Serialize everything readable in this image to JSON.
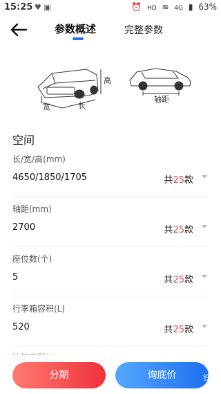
{
  "status_bar": {
    "time": "15:25",
    "left_icons": "♥ ▣",
    "hd": "HD",
    "network": "4G",
    "battery": "63%"
  },
  "nav": {
    "tabs": [
      {
        "label": "参数概述",
        "active": true
      },
      {
        "label": "完整参数",
        "active": false
      }
    ]
  },
  "diagram": {
    "height_label": "高",
    "width_label": "宽",
    "length_label": "长",
    "wheelbase_label": "轴距"
  },
  "section": {
    "title": "空间",
    "rows": [
      {
        "label": "长/宽/高(mm)",
        "value": "4650/1850/1705",
        "count_prefix": "共",
        "count_num": "25",
        "count_suffix": "款"
      },
      {
        "label": "轴距(mm)",
        "value": "2700",
        "count_prefix": "共",
        "count_num": "25",
        "count_suffix": "款"
      },
      {
        "label": "座位数(个)",
        "value": "5",
        "count_prefix": "共",
        "count_num": "25",
        "count_suffix": "款"
      },
      {
        "label": "行李箱容积(L)",
        "value": "520",
        "count_prefix": "共",
        "count_num": "25",
        "count_suffix": "款"
      }
    ],
    "partial_label": "油箱容积(L)"
  },
  "actions": {
    "installment": "分期",
    "inquiry": "询底价"
  },
  "watermark": "铁甲"
}
